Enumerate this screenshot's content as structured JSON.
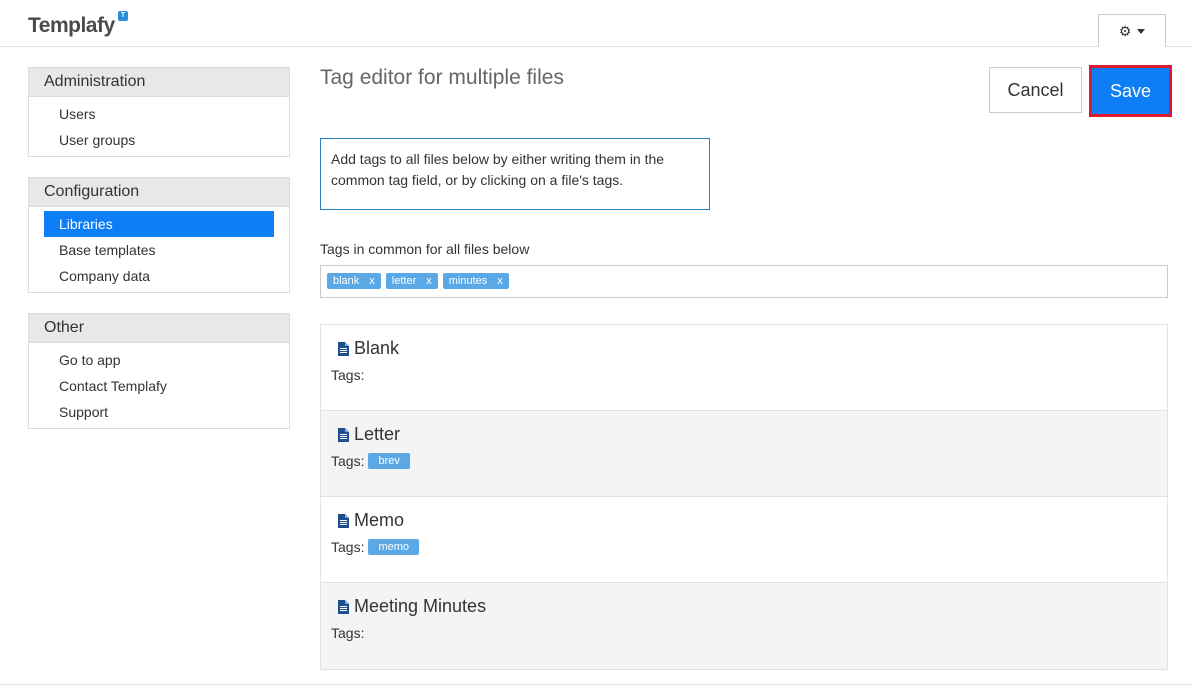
{
  "header": {
    "logo_text": "Templafy",
    "logo_badge": "T",
    "settings_icon": "gear-icon"
  },
  "sidebar": {
    "administration": {
      "title": "Administration",
      "items": [
        {
          "label": "Users"
        },
        {
          "label": "User groups"
        }
      ]
    },
    "configuration": {
      "title": "Configuration",
      "items": [
        {
          "label": "Libraries",
          "active": true
        },
        {
          "label": "Base templates"
        },
        {
          "label": "Company data"
        }
      ]
    },
    "other": {
      "title": "Other",
      "items": [
        {
          "label": "Go to app"
        },
        {
          "label": "Contact Templafy"
        },
        {
          "label": "Support"
        }
      ]
    }
  },
  "main": {
    "title": "Tag editor for multiple files",
    "cancel_label": "Cancel",
    "save_label": "Save",
    "info_text": "Add tags to all files below by either writing them in the common tag field, or by clicking on a file's tags.",
    "common_tags_label": "Tags in common for all files below",
    "common_tags": [
      {
        "label": "blank",
        "remove": "x"
      },
      {
        "label": "letter",
        "remove": "x"
      },
      {
        "label": "minutes",
        "remove": "x"
      }
    ],
    "tags_prefix": "Tags:",
    "files": [
      {
        "name": "Blank",
        "tags": []
      },
      {
        "name": "Letter",
        "tags": [
          "brev"
        ]
      },
      {
        "name": "Memo",
        "tags": [
          "memo"
        ]
      },
      {
        "name": "Meeting Minutes",
        "tags": []
      }
    ]
  },
  "colors": {
    "accent": "#0d7ef5",
    "tag": "#5aa9e6",
    "highlight_outline": "#e0182d"
  }
}
